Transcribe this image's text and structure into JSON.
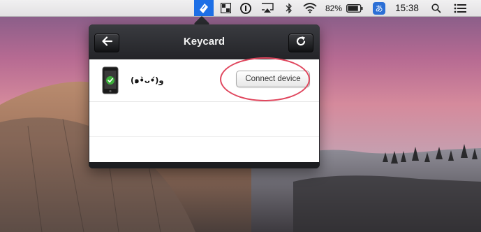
{
  "menubar": {
    "battery_percent": "82%",
    "time": "15:38",
    "ime_char": "あ",
    "icons": [
      "keycard-app-icon",
      "window-manager-icon",
      "onepassword-icon",
      "airplay-icon",
      "bluetooth-icon",
      "wifi-icon",
      "battery-icon",
      "input-method-icon",
      "spotlight-search-icon",
      "notification-center-icon"
    ]
  },
  "popover": {
    "title": "Keycard",
    "back_icon": "back-arrow-icon",
    "refresh_icon": "refresh-icon",
    "device": {
      "name": "(๑•̀ᴗ•́)و",
      "status_icon": "check-icon",
      "button_label": "Connect device"
    }
  },
  "colors": {
    "menubar_active": "#1d6fe6",
    "popover_header": "#26272b",
    "check_green": "#3cae3a",
    "highlight_ring": "#e0475e"
  }
}
